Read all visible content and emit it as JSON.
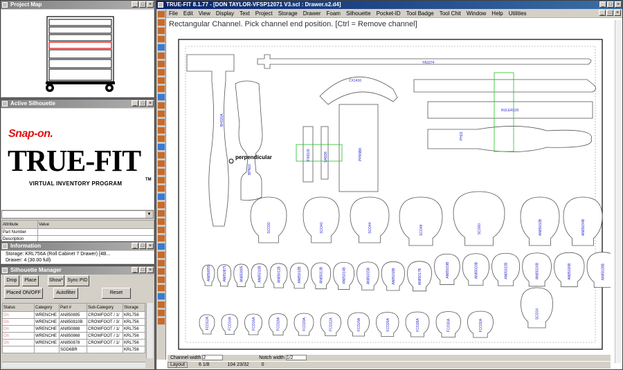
{
  "project_map": {
    "title": "Project Map"
  },
  "active_silhouette": {
    "title": "Active Silhouette",
    "brand": "Snap-on.",
    "product": "TRUE-FIT",
    "tagline": "VIRTUAL INVENTORY PROGRAM",
    "tm": "TM"
  },
  "attributes": {
    "headers": [
      "Attribute",
      "Value"
    ],
    "rows": [
      "Part Number",
      "Description"
    ]
  },
  "information": {
    "title": "Information",
    "storage_label": "Storage:",
    "storage_value": "KRL756A (Roll Cabinet 7 Drawer) [4B...",
    "drawer_label": "Drawer:",
    "drawer_value": "4 (30.00 full)"
  },
  "silhouette_manager": {
    "title": "Silhouette Manager",
    "buttons": {
      "drop": "Drop",
      "place": "Place",
      "show": "Show*",
      "sync": "Sync PID",
      "placed": "Placed ON/OFF",
      "autofilter": "Autofilter",
      "reset": "Reset"
    },
    "columns": [
      "Status",
      "Category",
      "Part #",
      "Sub-Category",
      "Storage"
    ],
    "rows": [
      [
        "On",
        "WRENCHE",
        "AN850895",
        "CROWFOOT / 1/",
        "KRL756"
      ],
      [
        "On",
        "WRENCHE",
        "AN850810B",
        "CROWFOOT / 3/",
        "KRL756"
      ],
      [
        "On",
        "WRENCHE",
        "AN850888",
        "CROWFOOT / 1/",
        "KRL756"
      ],
      [
        "On",
        "WRENCHE",
        "AN850868",
        "CROWFOOT / 1/",
        "KRL756"
      ],
      [
        "On",
        "WRENCHE",
        "AN850878",
        "CROWFOOT / 1/",
        "KRL756"
      ],
      [
        "",
        "",
        "SGD6BR",
        "",
        "KRL756"
      ]
    ]
  },
  "main": {
    "title": "TRUE-FIT 8.1.77 - [DON TAYLOR-VFSP12071 V3.scl : Drawer.s2.d4]",
    "menu": [
      "File",
      "Edit",
      "View",
      "Display",
      "Text",
      "Project",
      "Storage",
      "Drawer",
      "Foam",
      "Silhouette",
      "Pocket-ID",
      "Tool Badge",
      "Tool Chit",
      "Window",
      "Help",
      "Utilities"
    ],
    "instruction": "Rectangular Channel. Pick channel end position.  [Ctrl = Remove channel]",
    "cursor_label": "perpendicular",
    "status": {
      "channel_width_label": "Channel width",
      "channel_width_value": "2",
      "notch_width_label": "Notch width",
      "notch_width_value": "1/2"
    },
    "bottom": {
      "layout": "Layout",
      "coord1": "6 1/8",
      "coord2": "104 23/32",
      "coord3": "0"
    }
  },
  "tool_labels": {
    "ratchet": "YA3374",
    "hammer": "BH320A",
    "flex": "CX1416",
    "ruler": "RULER120",
    "pry": "PH22",
    "mallet": "BPN16",
    "block": "PPR9BK",
    "flex1": "FX8100",
    "flex2": "SA5D8",
    "sockets_big": [
      "SCO30",
      "SCO40",
      "SCO44",
      "SCO48",
      "SCO60",
      "AN85032B",
      "AN85034B"
    ],
    "sockets_mid": [
      "AN850855",
      "AN850875",
      "AN850895",
      "AN85010B",
      "AN85011B",
      "AN85012B",
      "AN85013B",
      "AN85014B",
      "AN85015B",
      "AN85016B",
      "AN85017B",
      "AN85019B",
      "AN85020B",
      "AN85022B",
      "AN85024B",
      "AN85026B",
      "AN85028B",
      "AN85030B"
    ],
    "sockets_bot": [
      "FCO12A",
      "FCO14A",
      "FCO16A",
      "FCO18A",
      "FCO20A",
      "FCO22A",
      "FCO24A",
      "FCO26A",
      "FCO28A",
      "FCO30A",
      "FCO32A",
      "SCO34"
    ]
  }
}
